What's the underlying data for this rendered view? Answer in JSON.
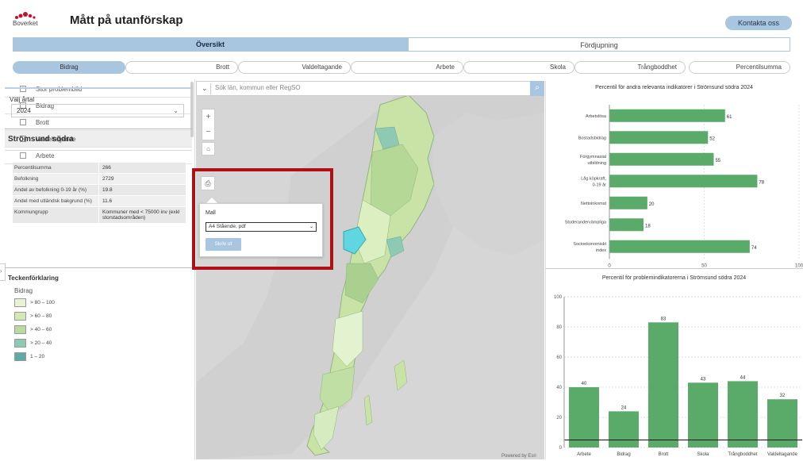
{
  "header": {
    "logo_text": "Boverket",
    "title": "Mått på utanförskap",
    "contact_label": "Kontakta oss"
  },
  "main_tabs": [
    {
      "label": "Översikt",
      "active": true
    },
    {
      "label": "Fördjupning",
      "active": false
    }
  ],
  "sub_tabs": [
    {
      "label": "Bidrag",
      "active": true
    },
    {
      "label": "Brott",
      "active": false
    },
    {
      "label": "Valdeltagande",
      "active": false
    },
    {
      "label": "Arbete",
      "active": false
    },
    {
      "label": "Skola",
      "active": false
    },
    {
      "label": "Trångboddhet",
      "active": false
    },
    {
      "label": "Percentilsumma",
      "active": false
    }
  ],
  "layers": [
    {
      "label": "Stor problembild"
    },
    {
      "label": "Bidrag"
    },
    {
      "label": "Brott"
    },
    {
      "label": "Valdeltagande"
    },
    {
      "label": "Arbete"
    }
  ],
  "year": {
    "label": "Välj årtal",
    "value": "2024"
  },
  "area": {
    "name": "Strömsund södra",
    "stats": [
      {
        "key": "Percentilsumma",
        "value": "266"
      },
      {
        "key": "Befolkning",
        "value": "2729"
      },
      {
        "key": "Andel av befolkning 0-19 år (%)",
        "value": "19.8"
      },
      {
        "key": "Andel med utländsk bakgrund (%)",
        "value": "11.6"
      },
      {
        "key": "Kommungrupp",
        "value": "Kommuner med < 75000 inv (exkl storstadsområden)"
      }
    ]
  },
  "legend": {
    "title": "Teckenförklaring",
    "subtitle": "Bidrag",
    "items": [
      {
        "label": "> 80 – 100",
        "color": "#e8f2d4"
      },
      {
        "label": "> 60 – 80",
        "color": "#d3e8b4"
      },
      {
        "label": "> 40 – 60",
        "color": "#b9dba0"
      },
      {
        "label": "> 20 – 40",
        "color": "#8ec9b3"
      },
      {
        "label": "1 – 20",
        "color": "#5fa9a6"
      }
    ]
  },
  "map": {
    "search_placeholder": "Sök län, kommun eller RegSO",
    "powered_by": "Powered by Esri"
  },
  "print": {
    "template_label": "Mall",
    "template_value": "A4 Stående, pdf",
    "print_button": "Skriv ut"
  },
  "colors": {
    "accent": "#a9c6e0",
    "bar": "#5aaa6a",
    "highlight": "#b10f12"
  },
  "chart_data": [
    {
      "type": "bar",
      "orientation": "horizontal",
      "title": "Percentil för andra relevanta indikatorer i Strömsund södra 2024",
      "categories": [
        "Arbetslösa",
        "Bostadsbidrag",
        "Förgymnasial utbildning",
        "Låg köpkraft, 0-19 år",
        "Nettoinkomst",
        "Studerandervämpliga",
        "Socioekonomiskt index"
      ],
      "values": [
        61,
        52,
        55,
        78,
        20,
        18,
        74
      ],
      "xlim": [
        0,
        100
      ],
      "xticks": [
        0,
        50,
        100
      ]
    },
    {
      "type": "bar",
      "title": "Percentil för problemindikatorerna i Strömsund södra 2024",
      "categories": [
        "Arbete",
        "Bidrag",
        "Brott",
        "Skola",
        "Trångboddhet",
        "Valdeltagande"
      ],
      "values": [
        40,
        24,
        83,
        43,
        44,
        32
      ],
      "ylim": [
        0,
        100
      ],
      "yticks": [
        0,
        20,
        40,
        60,
        80,
        100
      ],
      "reference_line": 5,
      "grid": true
    }
  ]
}
